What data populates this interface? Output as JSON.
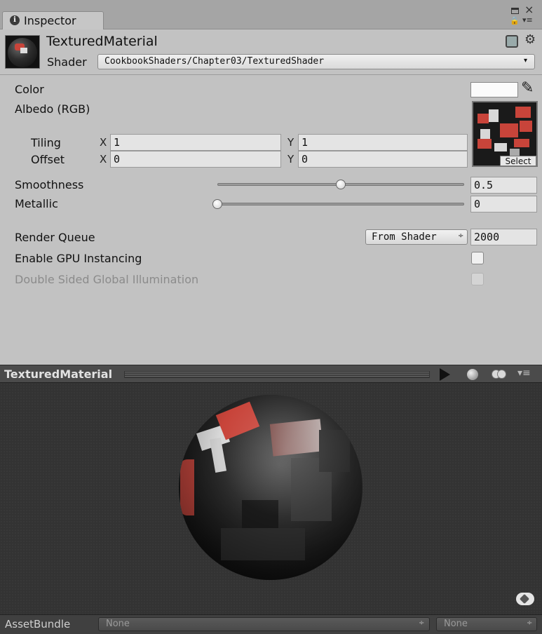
{
  "window": {
    "tab_label": "Inspector",
    "info_glyph": "i",
    "close_glyph": "×",
    "lock_glyph": "🔒",
    "menu_glyph": "▾≡"
  },
  "header": {
    "material_name": "TexturedMaterial",
    "shader_label": "Shader",
    "shader_value": "CookbookShaders/Chapter03/TexturedShader",
    "dropdown_arrow": "▾",
    "gear_glyph": "⚙",
    "icons": [
      "material-thumbnail",
      "help-book-icon",
      "gear-icon"
    ]
  },
  "properties": {
    "color_label": "Color",
    "color_value": "#fbfbfb",
    "eyedropper_glyph": "✎",
    "albedo_label": "Albedo (RGB)",
    "select_label": "Select",
    "tiling_label": "Tiling",
    "offset_label": "Offset",
    "x_label": "X",
    "y_label": "Y",
    "tiling_x": "1",
    "tiling_y": "1",
    "offset_x": "0",
    "offset_y": "0",
    "smoothness_label": "Smoothness",
    "smoothness_value": "0.5",
    "smoothness_fraction": 0.5,
    "metallic_label": "Metallic",
    "metallic_value": "0",
    "metallic_fraction": 0.0,
    "render_queue_label": "Render Queue",
    "render_queue_mode": "From Shader",
    "render_queue_arrow": "÷",
    "render_queue_value": "2000",
    "gpu_instancing_label": "Enable GPU Instancing",
    "gpu_instancing_checked": false,
    "dsgi_label": "Double Sided Global Illumination",
    "dsgi_checked": false,
    "dsgi_enabled": false
  },
  "preview": {
    "title": "TexturedMaterial",
    "menu_glyph": "▾≡",
    "colors": {
      "background": "#333333",
      "accent_red": "#c8443a",
      "tile_light": "#d8d8d8"
    }
  },
  "footer": {
    "label": "AssetBundle",
    "bundle_value": "None",
    "variant_value": "None",
    "arrow": "÷"
  }
}
